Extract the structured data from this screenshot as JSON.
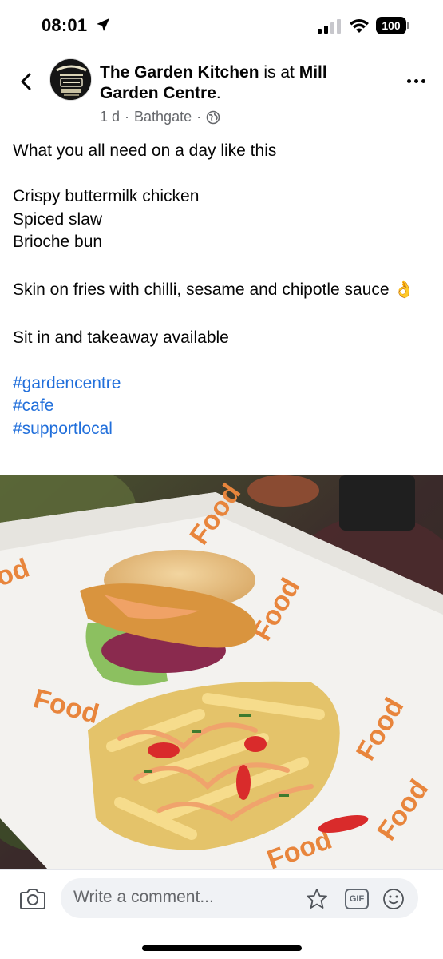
{
  "status_bar": {
    "time": "08:01",
    "battery": "100"
  },
  "header": {
    "page_name": "The Garden Kitchen",
    "connector": " is at ",
    "location": "Mill Garden Centre",
    "period": ".",
    "time_ago": "1 d",
    "place": "Bathgate",
    "separator": "·",
    "audience_icon": "globe-icon"
  },
  "post": {
    "line1": "What you all need on a day like this",
    "line2": "Crispy buttermilk chicken",
    "line3": "Spiced slaw",
    "line4": "Brioche bun",
    "line5": "Skin on fries with chilli, sesame and chipotle sauce 👌",
    "line6": "Sit in and takeaway available",
    "hashtags": [
      "#gardencentre",
      "#cafe",
      "#supportlocal"
    ]
  },
  "comment_bar": {
    "placeholder": "Write a comment...",
    "gif_label": "GIF"
  },
  "colors": {
    "link": "#216fdb",
    "meta": "#65676b",
    "input_bg": "#f0f2f5"
  }
}
